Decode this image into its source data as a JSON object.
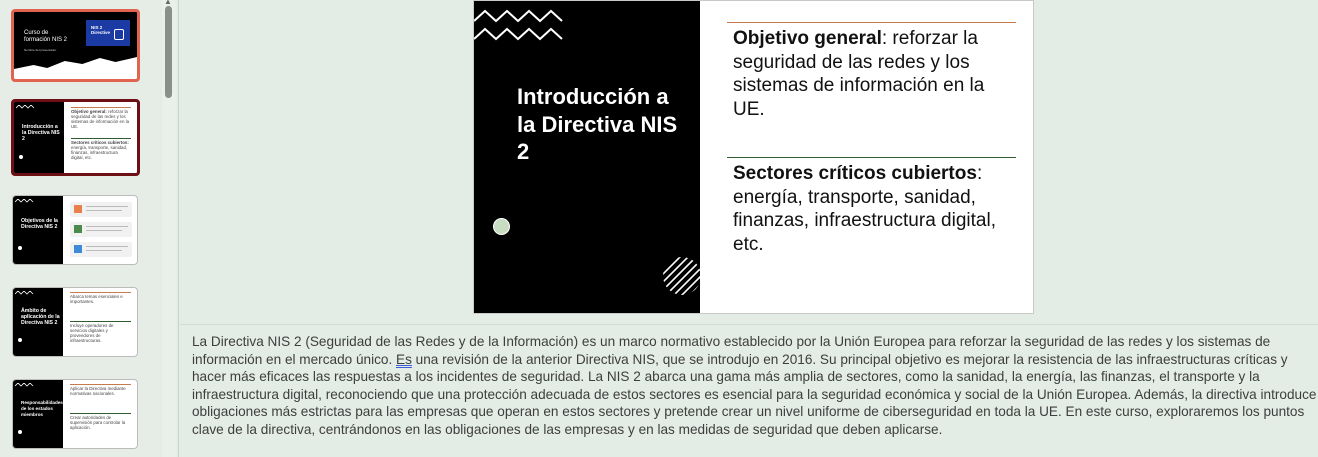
{
  "thumbnails": [
    {
      "index": 1,
      "title": "Curso de formación NIS 2",
      "subtitle": "Nombre del presentador",
      "flag_text": "NIS 2 Directive",
      "state": "selected"
    },
    {
      "index": 2,
      "title": "Introducción a la Directiva NIS 2",
      "text1_bold": "Objetivo general:",
      "text1": "reforzar la seguridad de las redes y los sistemas de información en la UE.",
      "text2_bold": "Sectores críticos cubiertos:",
      "text2": "energía, transporte, sanidad, finanzas, infraestructura digital, etc.",
      "state": "current"
    },
    {
      "index": 3,
      "title": "Objetivos de la Directiva NIS 2"
    },
    {
      "index": 4,
      "title": "Ámbito de aplicación de la Directiva NIS 2",
      "text1": "Abarca temas esenciales e importantes.",
      "text2": "Incluye operadores de servicios digitales y proveedores de infraestructuras."
    },
    {
      "index": 5,
      "title": "Responsabilidades de los estados miembros",
      "text1": "Aplicar la Directiva mediante normativas nacionales.",
      "text2": "Crear autoridades de supervisión para controlar la aplicación."
    }
  ],
  "slide": {
    "title": "Introducción a la Directiva NIS 2",
    "block1_bold": "Objetivo general",
    "block1_rest": ": reforzar la seguridad de las redes y los sistemas de información en la UE.",
    "block2_bold": "Sectores críticos cubiertos",
    "block2_rest": ": energía, transporte, sanidad, finanzas, infraestructura digital, etc."
  },
  "notes": {
    "part1": "La Directiva NIS 2 (Seguridad de las Redes y de la Información) es un marco normativo establecido por la Unión Europea para reforzar la seguridad de las redes y los sistemas de información en el mercado único. ",
    "flagged": "Es",
    "part2": " una revisión de la anterior Directiva NIS, que se introdujo en 2016. Su principal objetivo es mejorar la resistencia de las infraestructuras críticas y hacer más eficaces las respuestas a los incidentes de seguridad. La NIS 2 abarca una gama más amplia de sectores, como la sanidad, la energía, las finanzas, el transporte y la infraestructura digital, reconociendo que una protección adecuada de estos sectores es esencial para la seguridad económica y social de la Unión Europea. Además, la directiva introduce obligaciones más estrictas para las empresas que operan en estos sectores y pretende crear un nivel uniforme de ciberseguridad en toda la UE. En este curso, exploraremos los puntos clave de la directiva, centrándonos en las obligaciones de las empresas y en las medidas de seguridad que deben aplicarse."
  },
  "colors": {
    "selected_border": "#e06450",
    "current_border": "#6d0f14",
    "accent_orange": "#c57a4d",
    "accent_green": "#2f5d2f",
    "circle": "#c8dcc1",
    "flag_blue": "#1c3aa3"
  }
}
